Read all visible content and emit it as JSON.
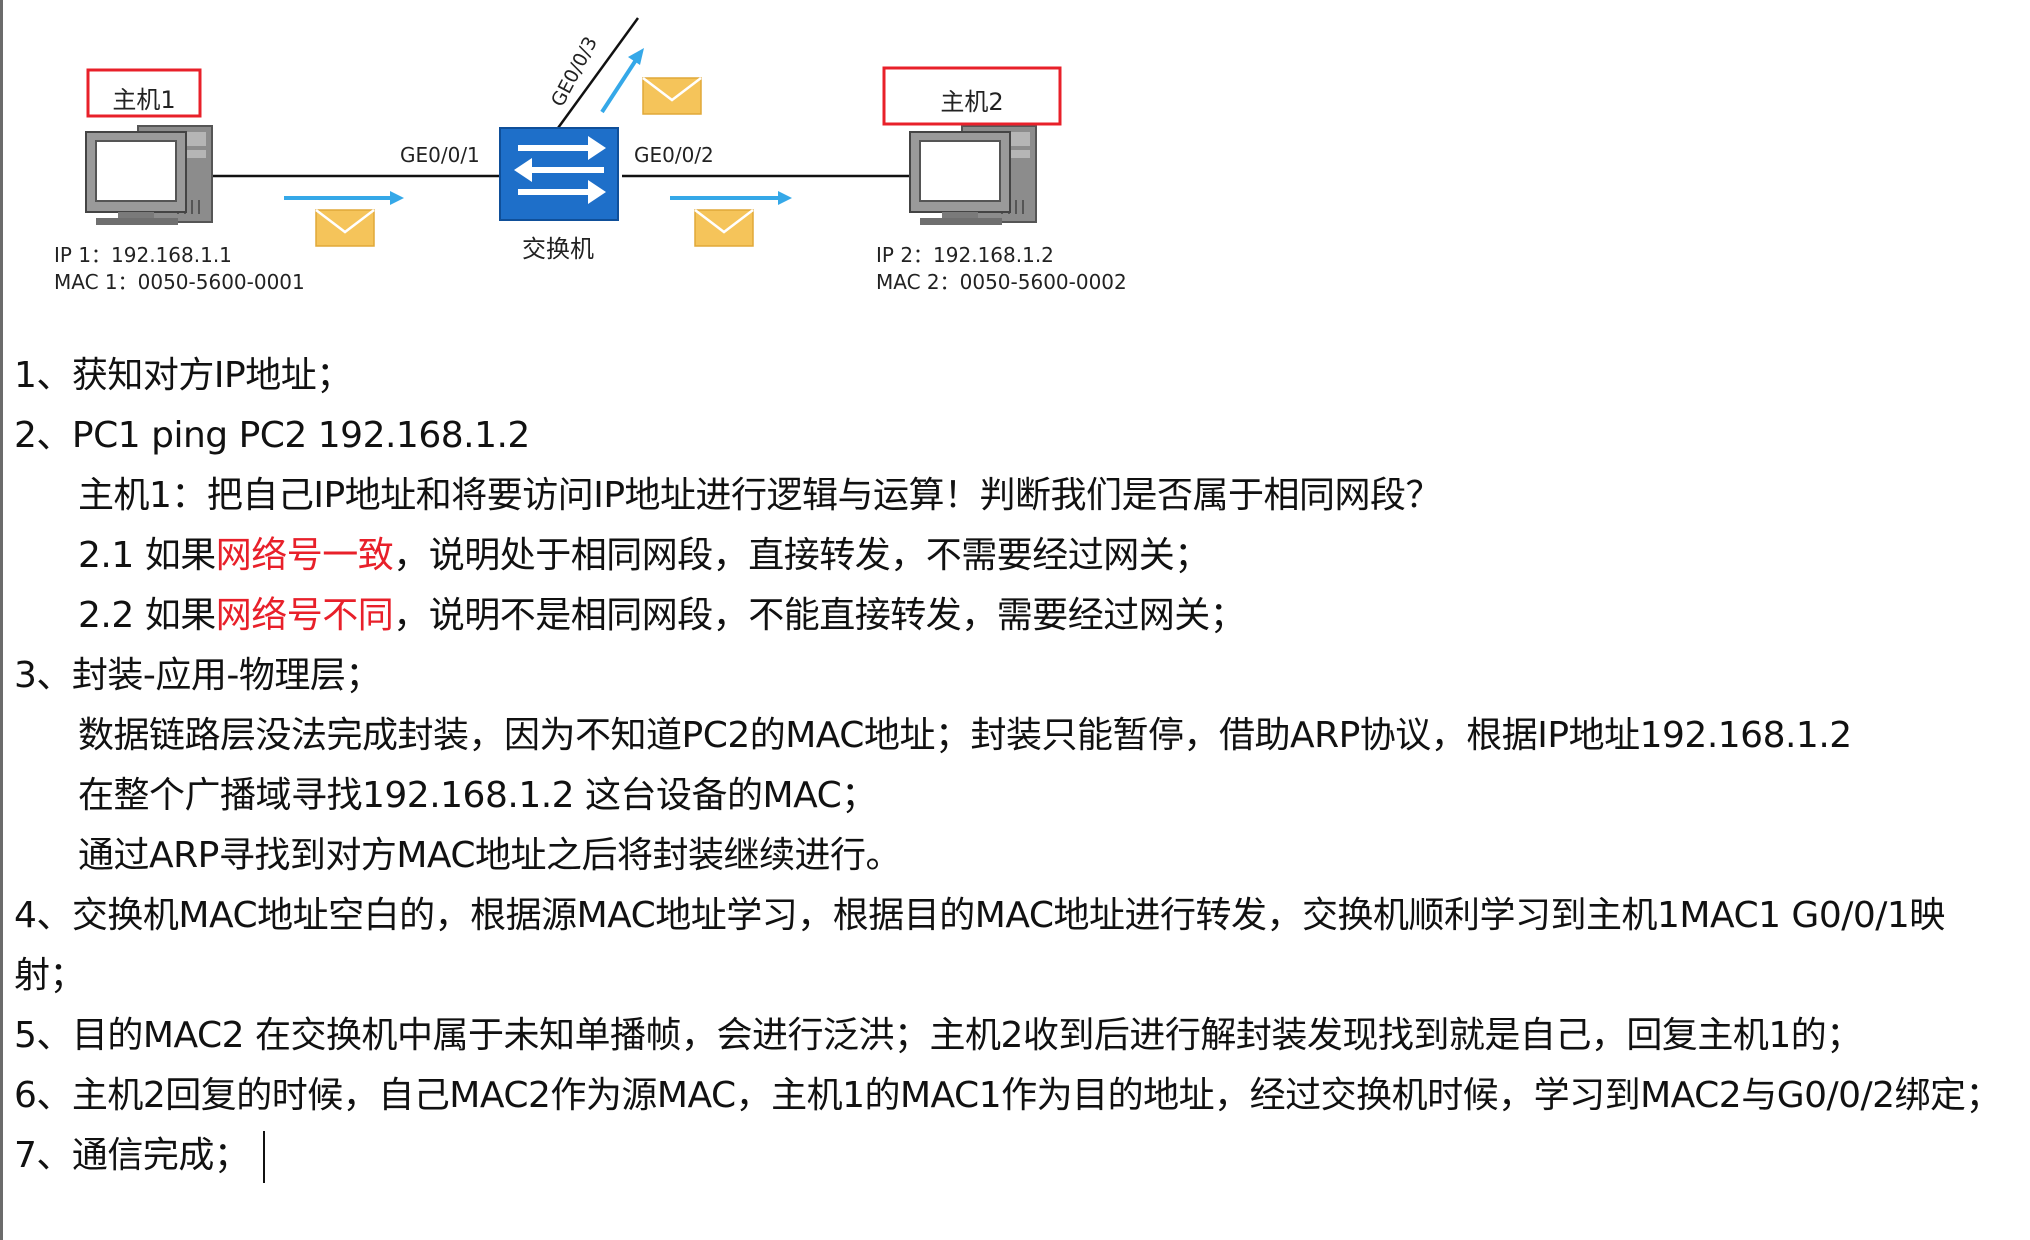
{
  "diagram": {
    "host1": {
      "label": "主机1",
      "ip": "IP 1：192.168.1.1",
      "mac": "MAC 1：0050-5600-0001"
    },
    "host2": {
      "label": "主机2",
      "ip": "IP 2：192.168.1.2",
      "mac": "MAC 2：0050-5600-0002"
    },
    "switch": {
      "label": "交换机"
    },
    "ports": {
      "p1": "GE0/0/1",
      "p2": "GE0/0/2",
      "p3": "GE0/0/3"
    },
    "colors": {
      "highlight_box": "#e8202a",
      "switch": "#1e6fc9",
      "arrow": "#35a8e8",
      "envelope": "#f5c45a"
    }
  },
  "notes": {
    "line1": "1、获知对方IP地址；",
    "line2": "2、PC1 ping PC2 192.168.1.2",
    "line3": "主机1：把自己IP地址和将要访问IP地址进行逻辑与运算！判断我们是否属于相同网段？",
    "line4": {
      "pre": "2.1 如果",
      "red": "网络号一致",
      "post": "，说明处于相同网段，直接转发，不需要经过网关；"
    },
    "line5": {
      "pre": "2.2 如果",
      "red": "网络号不同",
      "post": "，说明不是相同网段，不能直接转发，需要经过网关；"
    },
    "line6": "3、封装-应用-物理层；",
    "line7": "数据链路层没法完成封装，因为不知道PC2的MAC地址；封装只能暂停，借助ARP协议，根据IP地址192.168.1.2",
    "line8": "在整个广播域寻找192.168.1.2 这台设备的MAC；",
    "line9": "通过ARP寻找到对方MAC地址之后将封装继续进行。",
    "line10": "4、交换机MAC地址空白的，根据源MAC地址学习，根据目的MAC地址进行转发，交换机顺利学习到主机1MAC1 G0/0/1映",
    "line11": "射；",
    "line12": "5、目的MAC2 在交换机中属于未知单播帧，会进行泛洪；主机2收到后进行解封装发现找到就是自己，回复主机1的；",
    "line13": "6、主机2回复的时候，自己MAC2作为源MAC，主机1的MAC1作为目的地址，经过交换机时候，学习到MAC2与G0/0/2绑定；",
    "line14": "7、通信完成；"
  },
  "accent_color": "#e8202a"
}
